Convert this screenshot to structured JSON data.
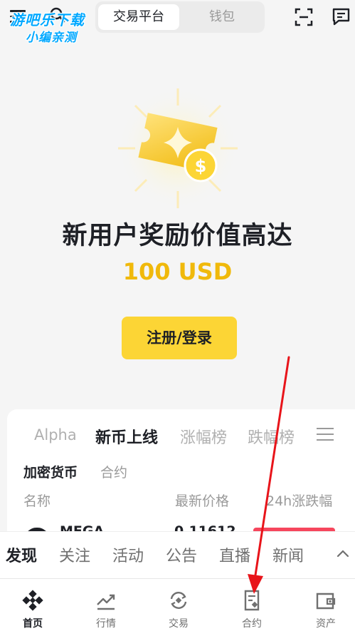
{
  "header": {
    "watermark_line1": "游吧乐下载",
    "watermark_line2": "小编亲测",
    "segments": [
      "交易平台",
      "钱包"
    ],
    "active_segment": "交易平台"
  },
  "hero": {
    "title": "新用户奖励价值高达",
    "amount": "100 USD",
    "cta_label": "注册/登录"
  },
  "market": {
    "tabs": [
      "Alpha",
      "新币上线",
      "涨幅榜",
      "跌幅榜"
    ],
    "active_tab": "新币上线",
    "subtabs": [
      "加密货币",
      "合约"
    ],
    "columns": [
      "名称",
      "最新价格",
      "24h涨跌幅"
    ],
    "first_row": {
      "name": "MEGA",
      "price": "0.11612"
    }
  },
  "feed": {
    "tabs": [
      "发现",
      "关注",
      "活动",
      "公告",
      "直播",
      "新闻"
    ],
    "active_tab": "发现"
  },
  "bottom_nav": {
    "items": [
      "首页",
      "行情",
      "交易",
      "合约",
      "资产"
    ],
    "active": "首页"
  },
  "colors": {
    "accent_yellow": "#fcd535",
    "amount_gold": "#f0b90b",
    "annotation_red": "#e8141a",
    "negative_red": "#f6465d"
  }
}
